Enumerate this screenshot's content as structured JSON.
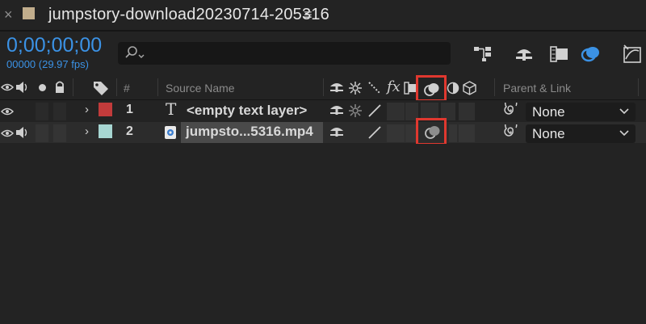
{
  "window": {
    "close_glyph": "×",
    "title": "jumpstory-download20230714-205316",
    "menu_glyph": "≡",
    "comp_swatch_color": "#c1ad8c"
  },
  "timecode": {
    "value": "0;00;00;00",
    "frames": "00000 (29.97 fps)"
  },
  "search": {
    "icon": "search-icon",
    "value": ""
  },
  "columns": {
    "number": "#",
    "source_name": "Source Name",
    "parent_link": "Parent & Link"
  },
  "layers": [
    {
      "number": "1",
      "type_glyph": "T",
      "name": "<empty text layer>",
      "label_color": "#c23b3b",
      "parent": "None",
      "motion_blur_highlighted": false
    },
    {
      "number": "2",
      "type_glyph": "⧉",
      "name": "jumpsto...5316.mp4",
      "label_color": "#a7d6d2",
      "parent": "None",
      "motion_blur_highlighted": true
    }
  ],
  "accent_color": "#3b92e5",
  "highlight_color": "#e0382f"
}
